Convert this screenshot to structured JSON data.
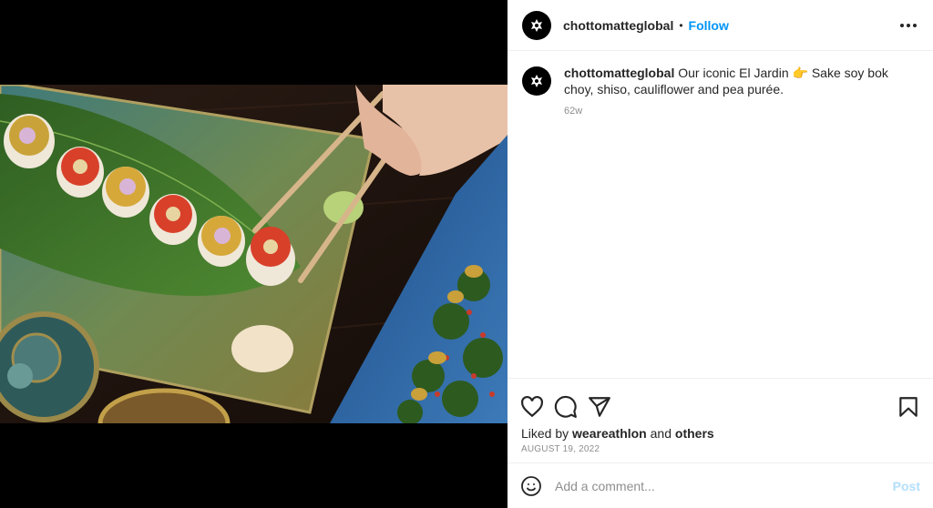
{
  "post": {
    "image_description": "sushi on bamboo leaf plate",
    "username": "chottomatteglobal",
    "separator": "•",
    "follow_label": "Follow",
    "caption": "Our iconic El Jardin 👉 Sake soy bok choy, shiso, cauliflower and pea purée.",
    "time_ago": "62w",
    "liked_by_prefix": "Liked by",
    "liked_by_user": "weareathlon",
    "liked_by_and": "and",
    "liked_by_others": "others",
    "date": "AUGUST 19, 2022",
    "comment_placeholder": "Add a comment...",
    "post_label": "Post"
  },
  "icons": {
    "more": "more-options-icon",
    "like": "heart-icon",
    "comment": "comment-icon",
    "share": "share-icon",
    "save": "bookmark-icon",
    "emoji": "emoji-icon"
  },
  "colors": {
    "link": "#0095f6",
    "post_disabled": "#b2dffc",
    "muted": "#8e8e8e",
    "text": "#262626"
  }
}
